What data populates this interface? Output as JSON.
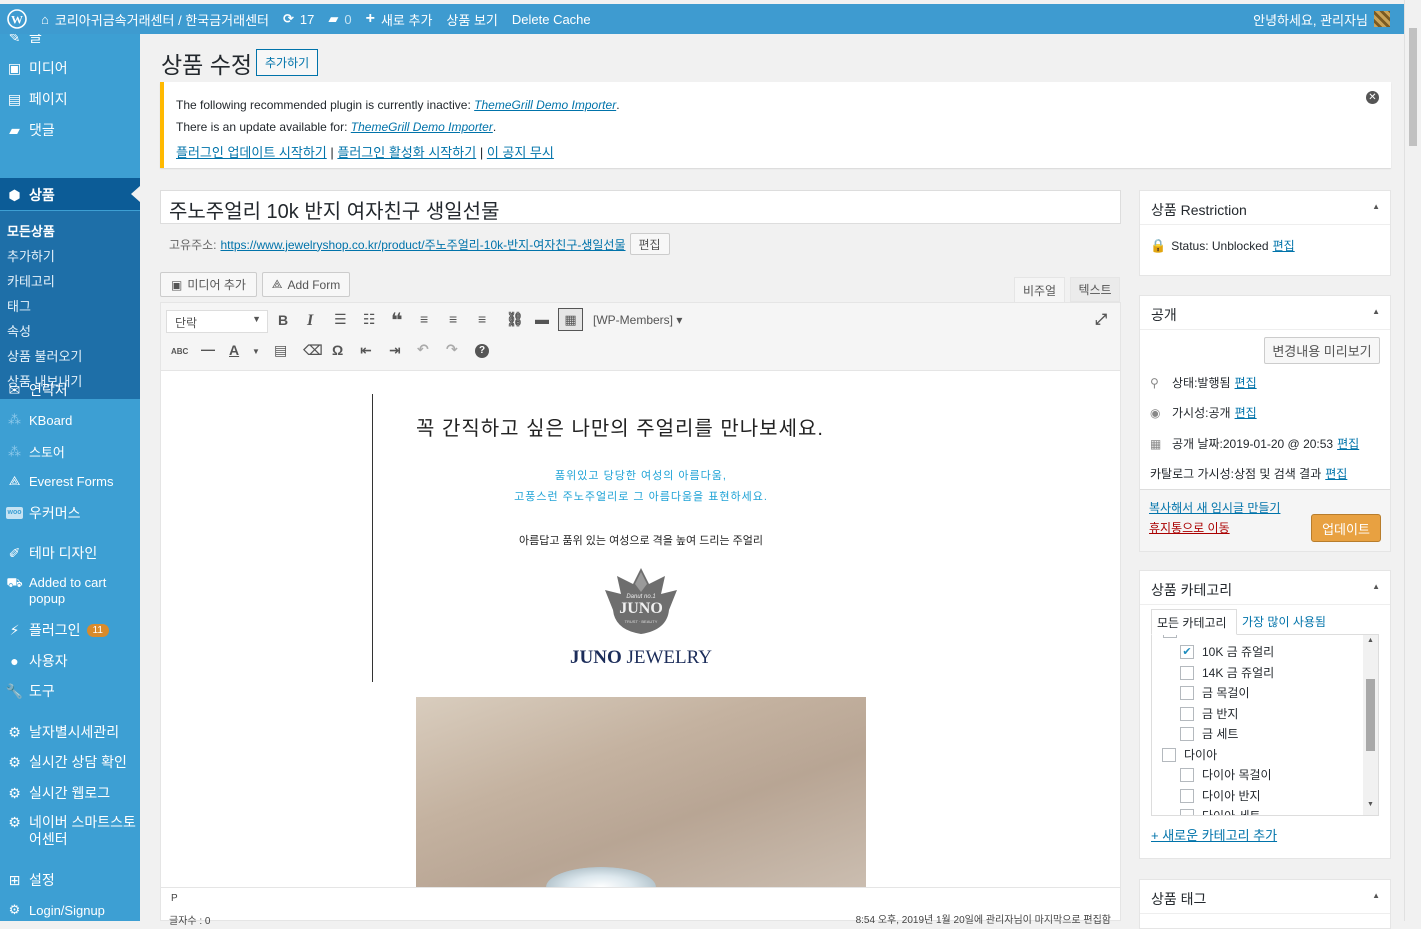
{
  "adminbar": {
    "site": "코리아귀금속거래센터 / 한국금거래센터",
    "updates": "17",
    "comments": "0",
    "new": "새로 추가",
    "view": "상품 보기",
    "cache": "Delete Cache",
    "howdy": "안녕하세요, 관리자님"
  },
  "menu": {
    "partial": "글",
    "media": "미디어",
    "pages": "페이지",
    "comments": "댓글",
    "products": "상품",
    "sub": [
      "모든상품",
      "추가하기",
      "카테고리",
      "태그",
      "속성",
      "상품 불러오기",
      "상품 내보내기"
    ],
    "contact": "연락처",
    "kboard": "KBoard",
    "store": "스토어",
    "everest": "Everest Forms",
    "woocommerce": "우커머스",
    "theme": "테마 디자인",
    "added_to_cart": "Added to cart popup",
    "plugins": "플러그인",
    "plugins_count": "11",
    "users": "사용자",
    "tools": "도구",
    "daily": "날자별시세관리",
    "chat": "실시간 상담 확인",
    "weblog": "실시간 웹로그",
    "naver": "네이버 스마트스토어센터",
    "settings": "설정",
    "login": "Login/Signup"
  },
  "page": {
    "title": "상품 수정",
    "add_new": "추가하기"
  },
  "notice": {
    "line1": "The following recommended plugin is currently inactive: ",
    "line1_link": "ThemeGrill Demo Importer",
    "line2": "There is an update available for: ",
    "line2_link": "ThemeGrill Demo Importer",
    "dot": ".",
    "l1": "플러그인 업데이트 시작하기",
    "l2": "플러그인 활성화 시작하기",
    "l3": "이 공지 무시",
    "sep": "|"
  },
  "post": {
    "title": "주노주얼리 10k 반지 여자친구 생일선물",
    "permalink_label": "고유주소:",
    "permalink": "https://www.jewelryshop.co.kr/product/주노주얼리-10k-반지-여자친구-생일선물",
    "edit": "편집"
  },
  "editor": {
    "add_media": "미디어 추가",
    "add_form": "Add Form",
    "tab_visual": "비주얼",
    "tab_text": "텍스트",
    "format": "단락",
    "wpmembers": "[WP-Members] ▾",
    "path": "P",
    "wordcount": "글자수 : 0",
    "lastedit": "8:54 오후, 2019년 1월 20일에 관리자님이 마지막으로 편집함"
  },
  "content": {
    "heading": "꼭 간직하고 싶은 나만의 주얼리를 만나보세요.",
    "sub1": "품위있고 당당한 여성의 아름다움,",
    "sub2": "고풍스런 주노주얼리로 그 아름다움을 표현하세요.",
    "body": "아름답고 품위 있는 여성으로 격을 높여 드리는 주얼리",
    "logo_small": "Danut no.1",
    "logo_juno": "JUNO",
    "logo_tag": "TRUST · BEAUTY",
    "brand1": "JUNO",
    "brand2": " JEWELRY"
  },
  "restriction": {
    "title": "상품 Restriction",
    "status": "Status: Unblocked",
    "edit": "편집"
  },
  "publish": {
    "title": "공개",
    "preview": "변경내용 미리보기",
    "status_label": "상태: ",
    "status": "발행됨",
    "vis_label": "가시성: ",
    "vis": "공개",
    "date_label": "공개 날짜: ",
    "date": "2019-01-20 @ 20:53",
    "catalog_label": "카탈로그 가시성: ",
    "catalog": "상점 및 검색 결과",
    "edit": "편집",
    "copy": "복사해서 새 임시글 만들기",
    "trash": "휴지통으로 이동",
    "update": "업데이트"
  },
  "categories": {
    "title": "상품 카테고리",
    "tab_all": "모든 카테고리",
    "tab_popular": "가장 많이 사용됨",
    "items": [
      {
        "label": "10K 금 쥬얼리",
        "checked": true
      },
      {
        "label": "14K 금 쥬얼리",
        "checked": false
      },
      {
        "label": "금 목걸이",
        "checked": false
      },
      {
        "label": "금 반지",
        "checked": false
      },
      {
        "label": "금 세트",
        "checked": false
      },
      {
        "label": "다이아",
        "checked": false
      },
      {
        "label": "다이아 목걸이",
        "checked": false
      },
      {
        "label": "다이아 반지",
        "checked": false
      },
      {
        "label": "다이아 세트",
        "checked": false
      }
    ],
    "add": "+ 새로운 카테고리 추가"
  },
  "tags": {
    "title": "상품 태그"
  }
}
